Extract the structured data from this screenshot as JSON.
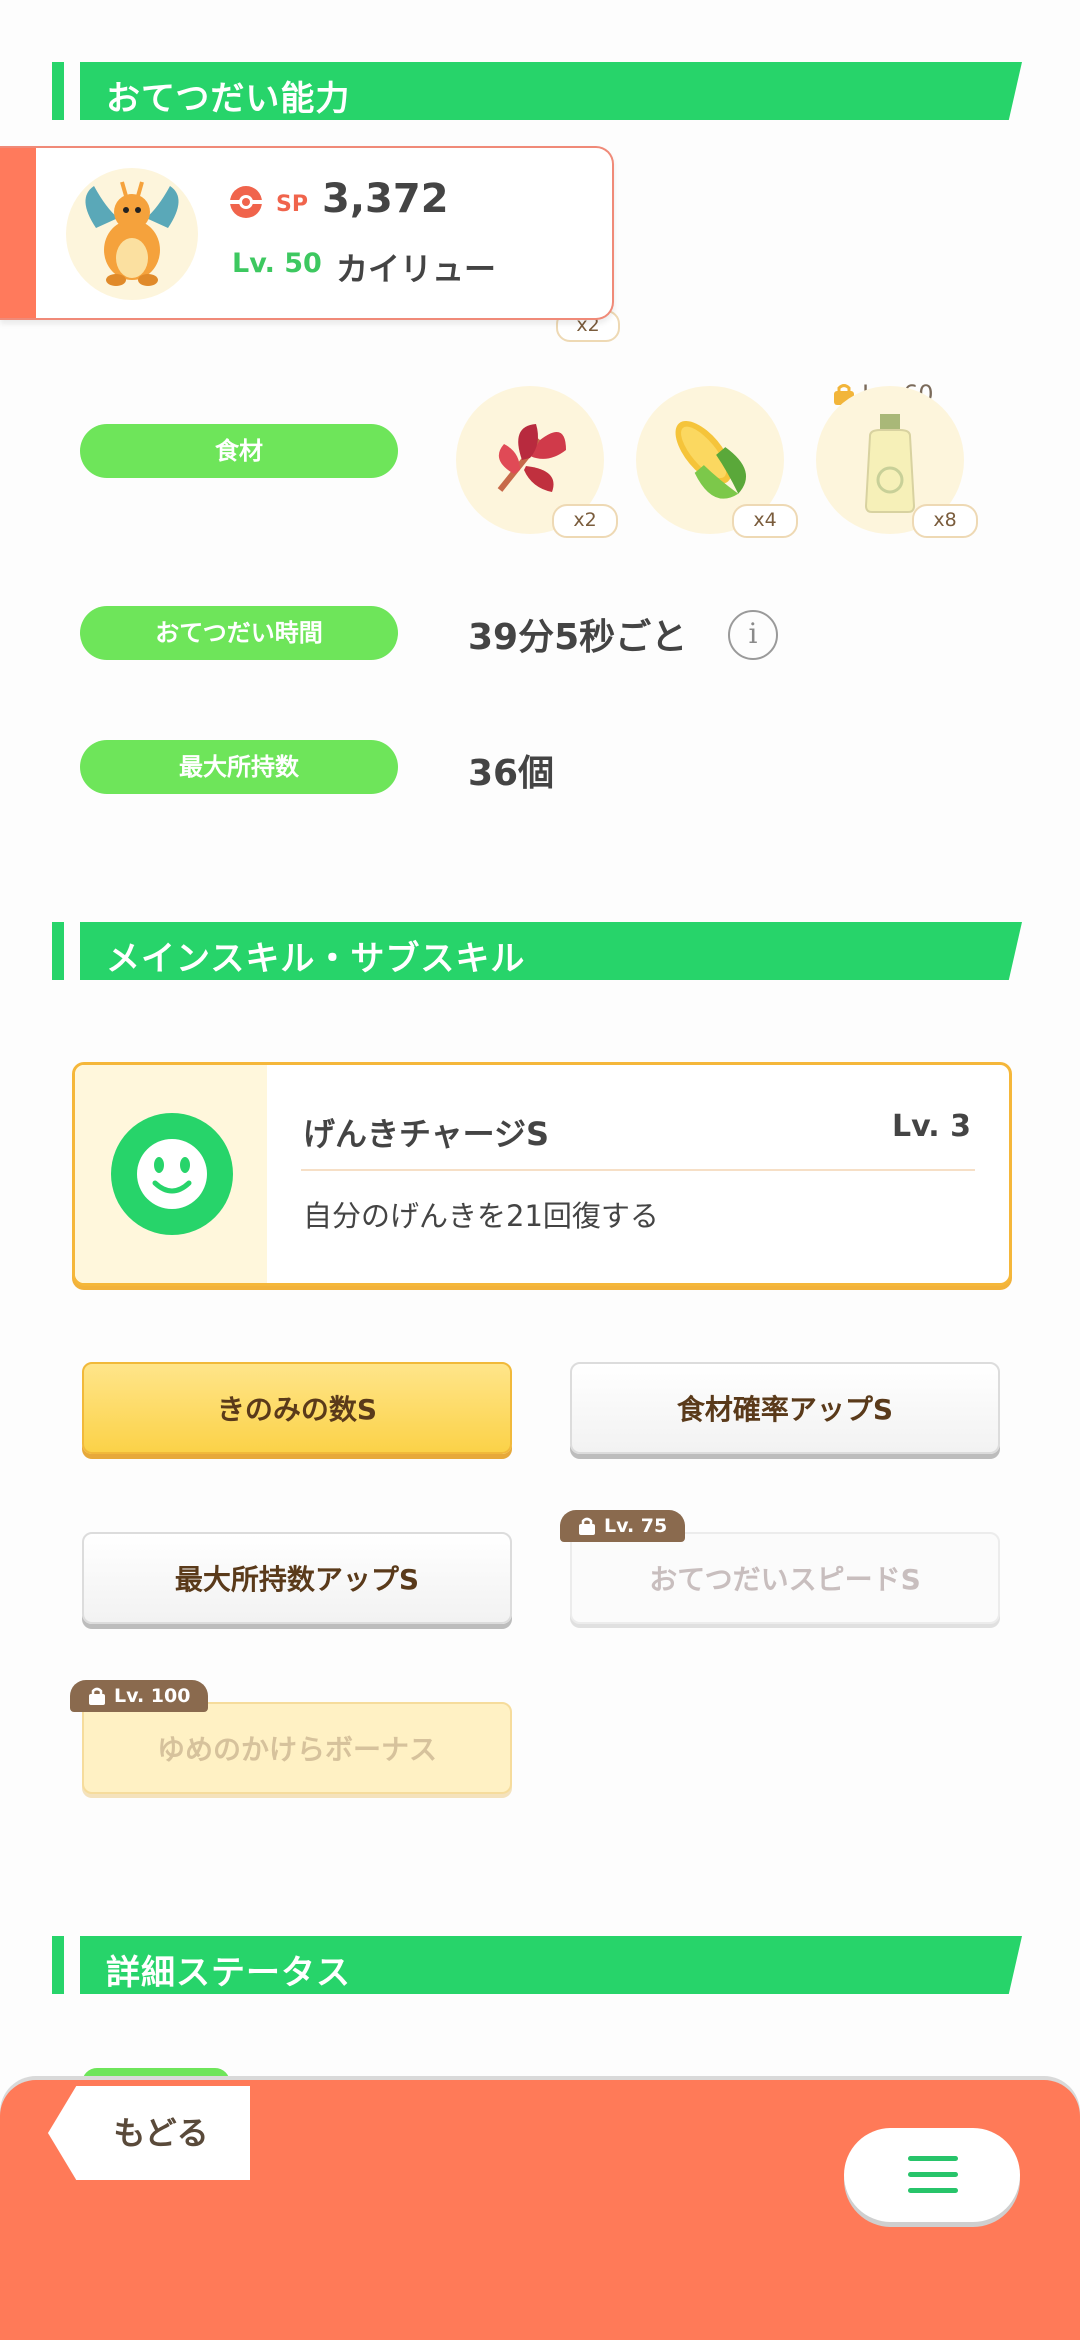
{
  "sections": {
    "helper": "おてつだい能力",
    "skills": "メインスキル・サブスキル",
    "details": "詳細ステータス"
  },
  "pokemon": {
    "sp_label": "SP",
    "sp_value": "3,372",
    "level_label": "Lv. 50",
    "name": "カイリュー",
    "hidden_count": "x2"
  },
  "ingredients": {
    "label": "食材",
    "items": [
      {
        "name": "red-leaf-ingredient",
        "count": "x2"
      },
      {
        "name": "corn-ingredient",
        "count": "x4"
      },
      {
        "name": "oil-bottle-ingredient",
        "count": "x8",
        "lock_level": "Lv. 60"
      }
    ]
  },
  "help_time": {
    "label": "おてつだい時間",
    "value": "39分5秒ごと"
  },
  "max_carry": {
    "label": "最大所持数",
    "value": "36個"
  },
  "main_skill": {
    "name": "げんきチャージS",
    "level": "Lv. 3",
    "description": "自分のげんきを21回復する",
    "accent": "#27d46a"
  },
  "sub_skills": [
    {
      "label": "きのみの数S",
      "state": "active-gold"
    },
    {
      "label": "食材確率アップS",
      "state": "active"
    },
    {
      "label": "最大所持数アップS",
      "state": "active"
    },
    {
      "label": "おてつだいスピードS",
      "state": "locked",
      "lock_level": "Lv. 75"
    },
    {
      "label": "ゆめのかけらボーナス",
      "state": "locked-gold",
      "lock_level": "Lv. 100"
    }
  ],
  "footer": {
    "back_label": "もどる",
    "menu_icon": "hamburger-menu-icon"
  },
  "colors": {
    "primary_green": "#27d46a",
    "pill_green": "#6ee55a",
    "coral": "#ff7a58",
    "gold": "#fbd248"
  }
}
